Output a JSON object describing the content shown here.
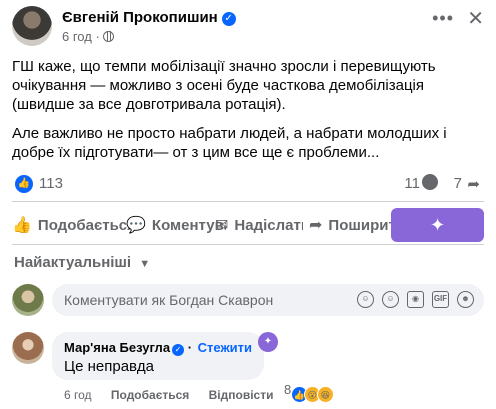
{
  "post": {
    "author": "Євгеній Прокопишин",
    "time": "6 год",
    "paragraph1": "ГШ каже, що темпи мобілізації значно зросли і перевищують очікування — можливо з осені буде часткова демобілізація (швидше за все довготривала ротація).",
    "paragraph2": "Але важливо не просто набрати людей, а набрати молодших і добре їх підготувати— от з цим все ще є проблеми..."
  },
  "stats": {
    "reactions": "113",
    "comments": "11",
    "shares": "7"
  },
  "actions": {
    "like": "Подобається",
    "comment": "Коментувати",
    "send": "Надіслати",
    "share": "Поширити"
  },
  "sort": {
    "label": "Найактуальніші"
  },
  "composer": {
    "placeholder": "Коментувати як Богдан Скаврон"
  },
  "comment": {
    "author": "Мар'яна Безугла",
    "follow": "Стежити",
    "text": "Це неправда",
    "time": "6 год",
    "like": "Подобається",
    "reply": "Відповісти",
    "reactions": "8"
  },
  "colors": {
    "accent": "#0866ff",
    "ai": "#8a67d8",
    "muted": "#65676b"
  }
}
